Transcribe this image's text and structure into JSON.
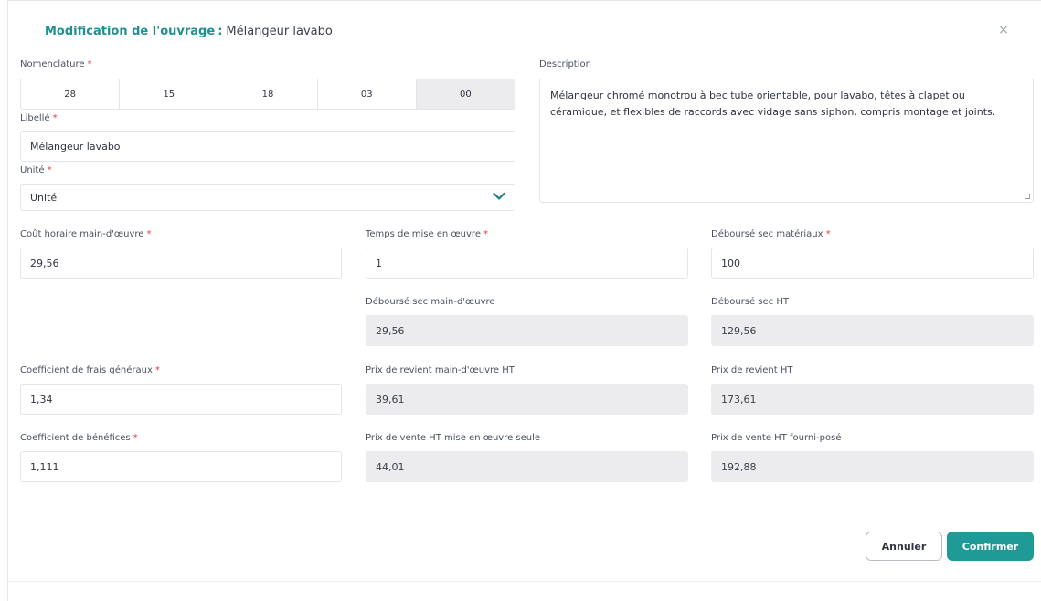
{
  "header": {
    "title_prefix": "Modification de l'ouvrage",
    "separator": ":",
    "title_name": "Mélangeur lavabo",
    "close_glyph": "×"
  },
  "form": {
    "required_mark": "*",
    "nomenclature": {
      "label": "Nomenclature",
      "codes": [
        "28",
        "15",
        "18",
        "03",
        "00"
      ]
    },
    "libelle": {
      "label": "Libellé",
      "value": "Mélangeur lavabo"
    },
    "unite": {
      "label": "Unité",
      "value": "Unité"
    },
    "description": {
      "label": "Description",
      "value": "Mélangeur chromé monotrou à bec tube orientable, pour lavabo, têtes à clapet ou céramique, et flexibles de raccords avec vidage sans siphon, compris montage et joints."
    },
    "cout_horaire": {
      "label": "Coût horaire main-d'œuvre",
      "value": "29,56"
    },
    "temps_mise": {
      "label": "Temps de mise en œuvre",
      "value": "1"
    },
    "debourse_materiaux": {
      "label": "Déboursé sec matériaux",
      "value": "100"
    },
    "debourse_mo": {
      "label": "Déboursé sec main-d'œuvre",
      "value": "29,56"
    },
    "debourse_ht": {
      "label": "Déboursé sec HT",
      "value": "129,56"
    },
    "coef_frais": {
      "label": "Coefficient de frais généraux",
      "value": "1,34"
    },
    "prix_revient_mo": {
      "label": "Prix de revient main-d'œuvre HT",
      "value": "39,61"
    },
    "prix_revient_ht": {
      "label": "Prix de revient HT",
      "value": "173,61"
    },
    "coef_benefices": {
      "label": "Coefficient de bénéfices",
      "value": "1,111"
    },
    "prix_vente_mo": {
      "label": "Prix de vente HT mise en œuvre seule",
      "value": "44,01"
    },
    "prix_vente_fp": {
      "label": "Prix de vente HT fourni-posé",
      "value": "192,88"
    }
  },
  "actions": {
    "cancel_label": "Annuler",
    "confirm_label": "Confirmer"
  },
  "colors": {
    "accent": "#1f9a96",
    "required": "#e23b3b",
    "readonly_bg": "#ececee"
  }
}
